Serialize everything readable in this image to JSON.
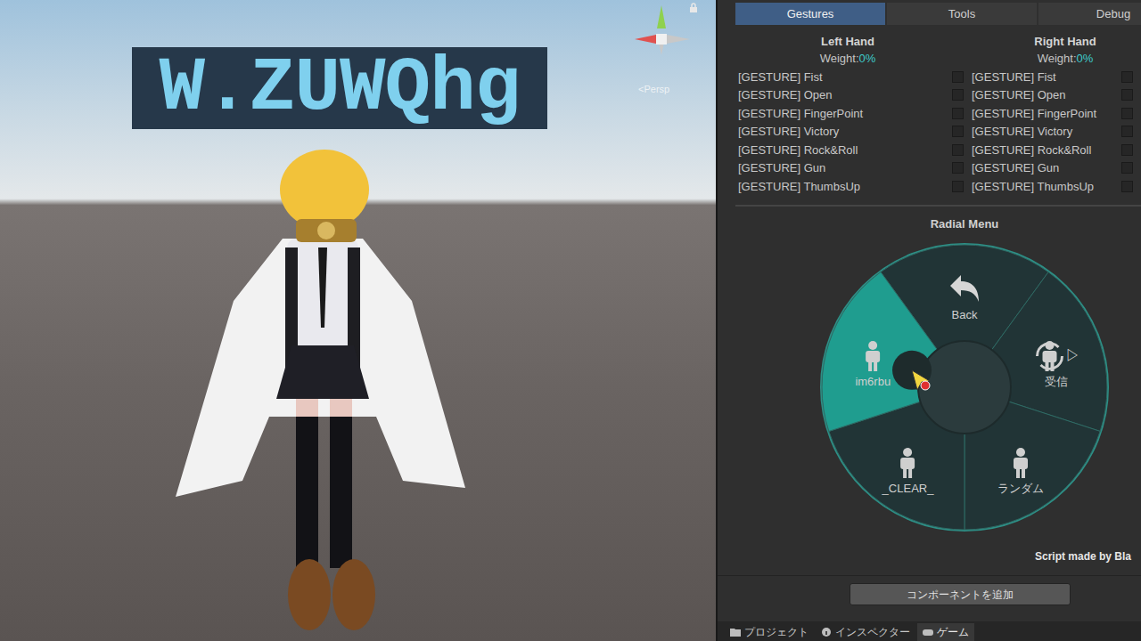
{
  "scene": {
    "label": "W.ZUWQhg",
    "view": "<Persp"
  },
  "tabs": [
    {
      "label": "Gestures",
      "selected": true
    },
    {
      "label": "Tools",
      "selected": false
    },
    {
      "label": "Debug",
      "selected": false
    }
  ],
  "hands": [
    {
      "title": "Left Hand",
      "weight_label": "Weight:",
      "weight": "0%",
      "gestures": [
        {
          "label": "[GESTURE] Fist",
          "checked": false
        },
        {
          "label": "[GESTURE] Open",
          "checked": false
        },
        {
          "label": "[GESTURE] FingerPoint",
          "checked": false
        },
        {
          "label": "[GESTURE] Victory",
          "checked": false
        },
        {
          "label": "[GESTURE] Rock&Roll",
          "checked": false
        },
        {
          "label": "[GESTURE] Gun",
          "checked": false
        },
        {
          "label": "[GESTURE] ThumbsUp",
          "checked": false
        }
      ]
    },
    {
      "title": "Right Hand",
      "weight_label": "Weight:",
      "weight": "0%",
      "gestures": [
        {
          "label": "[GESTURE] Fist",
          "checked": false
        },
        {
          "label": "[GESTURE] Open",
          "checked": false
        },
        {
          "label": "[GESTURE] FingerPoint",
          "checked": false
        },
        {
          "label": "[GESTURE] Victory",
          "checked": false
        },
        {
          "label": "[GESTURE] Rock&Roll",
          "checked": false
        },
        {
          "label": "[GESTURE] Gun",
          "checked": false
        },
        {
          "label": "[GESTURE] ThumbsUp",
          "checked": false
        }
      ]
    }
  ],
  "radial": {
    "title": "Radial Menu",
    "items": [
      {
        "label": "Back",
        "kind": "back",
        "selected": false
      },
      {
        "label": "受信",
        "kind": "submenu",
        "selected": false,
        "arrow": "▷"
      },
      {
        "label": "ランダム",
        "kind": "toggle",
        "selected": false
      },
      {
        "label": "_CLEAR_",
        "kind": "toggle",
        "selected": false
      },
      {
        "label": "im6rbu",
        "kind": "toggle",
        "selected": true
      }
    ]
  },
  "footer": "Script made by Bla",
  "add_button": "コンポーネントを追加",
  "bottom_tabs": [
    {
      "label": "プロジェクト",
      "selected": false
    },
    {
      "label": "インスペクター",
      "selected": false
    },
    {
      "label": "ゲーム",
      "selected": true
    }
  ]
}
